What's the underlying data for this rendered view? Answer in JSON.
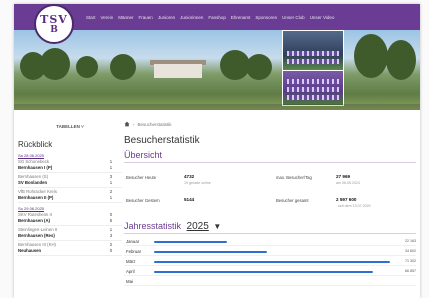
{
  "header": {
    "logo": {
      "line1": "TSV",
      "line2": "B"
    },
    "nav": [
      "Start",
      "Verein",
      "Männer",
      "Frauen",
      "Junioren",
      "Juniorinnen",
      "Fanshop",
      "Ehrenamt",
      "Sponsoren",
      "Unser Club",
      "Unser Video"
    ]
  },
  "sidebar": {
    "header": "TABELLEN",
    "title": "Rückblick",
    "groups": [
      {
        "date": "Sa 28.06.2025",
        "matches": [
          {
            "home": "SG Schonebeck",
            "away": "Bernhausen I (P)",
            "score_home": "1",
            "score_away": "1"
          },
          {
            "home": "Bernhausen (S)",
            "away": "SV Bonlanden",
            "score_home": "3",
            "score_away": "1"
          },
          {
            "home": "VfB Rohracker Kreis",
            "away": "Bernhausen II (P)",
            "score_home": "2",
            "score_away": "1"
          }
        ]
      },
      {
        "date": "So 29.06.2025",
        "matches": [
          {
            "home": "SKV Rutesheim II",
            "away": "Bernhausen (A)",
            "score_home": "0",
            "score_away": "5"
          },
          {
            "home": "Steinlingen-Leinen II",
            "away": "Bernhausen (Res)",
            "score_home": "1",
            "score_away": "3"
          },
          {
            "home": "Bernhausen III (KH)",
            "away": "Neuhausen",
            "score_home": "2",
            "score_away": "0"
          }
        ]
      }
    ]
  },
  "main": {
    "breadcrumb": "Besucherstatistik",
    "title": "Besucherstatistik",
    "subtitle": "Übersicht",
    "stats": [
      {
        "label": "Besucher Heute",
        "value": "4732",
        "sub": "19 gerade online"
      },
      {
        "label": "max. Besucher/Tag",
        "value": "27 969",
        "sub": "am 06.05.2024"
      },
      {
        "label": "Besucher Gestern",
        "value": "5144",
        "sub": ""
      },
      {
        "label": "Besucher gesamt",
        "value": "2 597 600",
        "sub": "seit dem 13.07.2020"
      }
    ],
    "yearly": {
      "label": "Jahresstatistik",
      "year": "2025",
      "caret": "▼",
      "max": 71000,
      "months": [
        {
          "name": "Januar",
          "value": 22000,
          "display": "22 163"
        },
        {
          "name": "Februar",
          "value": 34000,
          "display": "34 602"
        },
        {
          "name": "März",
          "value": 71000,
          "display": "71 302"
        },
        {
          "name": "April",
          "value": 66000,
          "display": "66 857"
        },
        {
          "name": "Mai",
          "value": 0,
          "display": ""
        }
      ]
    }
  },
  "colors": {
    "brand": "#6a3c93",
    "bar": "#2f6fd1"
  }
}
